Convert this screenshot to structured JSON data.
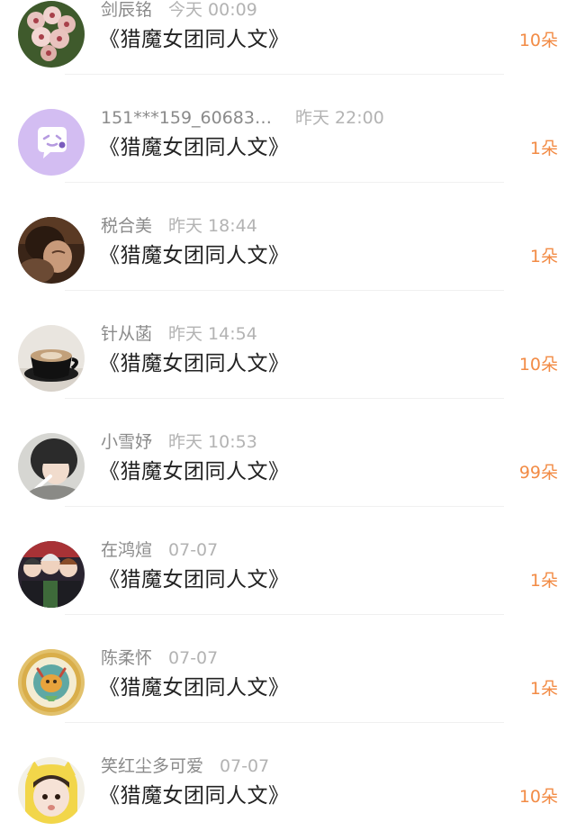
{
  "colors": {
    "flower_count": "#f28b45",
    "username": "#8a8a8a",
    "time": "#b3b3b3",
    "title": "#222222"
  },
  "items": [
    {
      "username": "剑辰铭",
      "time": "今天 00:09",
      "title": "《猎魔女团同人文》",
      "flowers": "10朵",
      "avatar": "flower-photo"
    },
    {
      "username": "151***159_60683…",
      "time": "昨天 22:00",
      "title": "《猎魔女团同人文》",
      "flowers": "1朵",
      "avatar": "default-chat-icon"
    },
    {
      "username": "税合美",
      "time": "昨天 18:44",
      "title": "《猎魔女团同人文》",
      "flowers": "1朵",
      "avatar": "person-photo"
    },
    {
      "username": "针从菡",
      "time": "昨天 14:54",
      "title": "《猎魔女团同人文》",
      "flowers": "10朵",
      "avatar": "coffee-cup-photo"
    },
    {
      "username": "小雪妤",
      "time": "昨天 10:53",
      "title": "《猎魔女团同人文》",
      "flowers": "99朵",
      "avatar": "girl-photo"
    },
    {
      "username": "在鸿煊",
      "time": "07-07",
      "title": "《猎魔女团同人文》",
      "flowers": "1朵",
      "avatar": "anime-group-photo"
    },
    {
      "username": "陈柔怀",
      "time": "07-07",
      "title": "《猎魔女团同人文》",
      "flowers": "1朵",
      "avatar": "gold-coin-photo"
    },
    {
      "username": "笑红尘多可爱",
      "time": "07-07",
      "title": "《猎魔女团同人文》",
      "flowers": "10朵",
      "avatar": "child-yellow-hood-photo"
    }
  ]
}
